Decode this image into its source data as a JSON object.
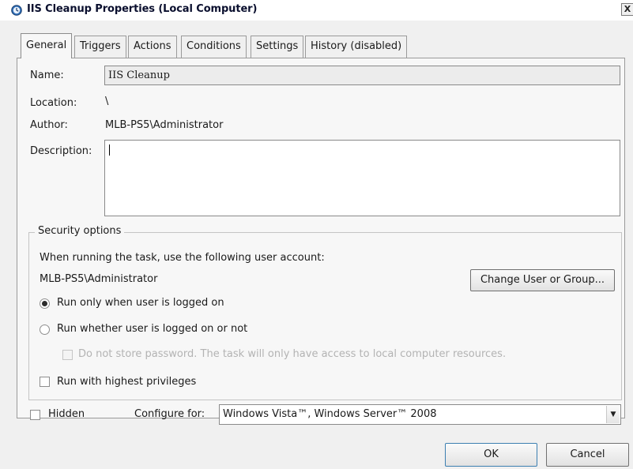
{
  "window": {
    "title": "IIS Cleanup Properties (Local Computer)",
    "close_glyph": "X"
  },
  "tabs": [
    {
      "label": "General",
      "active": true
    },
    {
      "label": "Triggers",
      "active": false
    },
    {
      "label": "Actions",
      "active": false
    },
    {
      "label": "Conditions",
      "active": false
    },
    {
      "label": "Settings",
      "active": false
    },
    {
      "label": "History (disabled)",
      "active": false
    }
  ],
  "general": {
    "name_label": "Name:",
    "name_value": "IIS Cleanup",
    "location_label": "Location:",
    "location_value": "\\",
    "author_label": "Author:",
    "author_value": "MLB-PS5\\Administrator",
    "description_label": "Description:",
    "description_value": ""
  },
  "security": {
    "title": "Security options",
    "account_prompt": "When running the task, use the following user account:",
    "account_value": "MLB-PS5\\Administrator",
    "change_button": "Change User or Group...",
    "radio_logged_on": "Run only when user is logged on",
    "radio_logged_on_checked": true,
    "radio_whether": "Run whether user is logged on or not",
    "radio_whether_checked": false,
    "no_store_password": "Do not store password.  The task will only have access to local computer resources.",
    "no_store_password_enabled": false,
    "highest_privileges": "Run with highest privileges",
    "highest_privileges_checked": false
  },
  "bottom": {
    "hidden_label": "Hidden",
    "hidden_checked": false,
    "configure_label": "Configure for:",
    "configure_value": "Windows Vista™, Windows Server™ 2008",
    "ok_button": "OK",
    "cancel_button": "Cancel"
  },
  "icons": {
    "title_icon": "task-scheduler-icon",
    "combo_arrow": "chevron-down-icon"
  },
  "colors": {
    "title_text": "#0a0f2e",
    "dialog_bg": "#f0f0f0",
    "panel_bg": "#f7f7f7",
    "disabled_text": "#b3b3b3"
  }
}
